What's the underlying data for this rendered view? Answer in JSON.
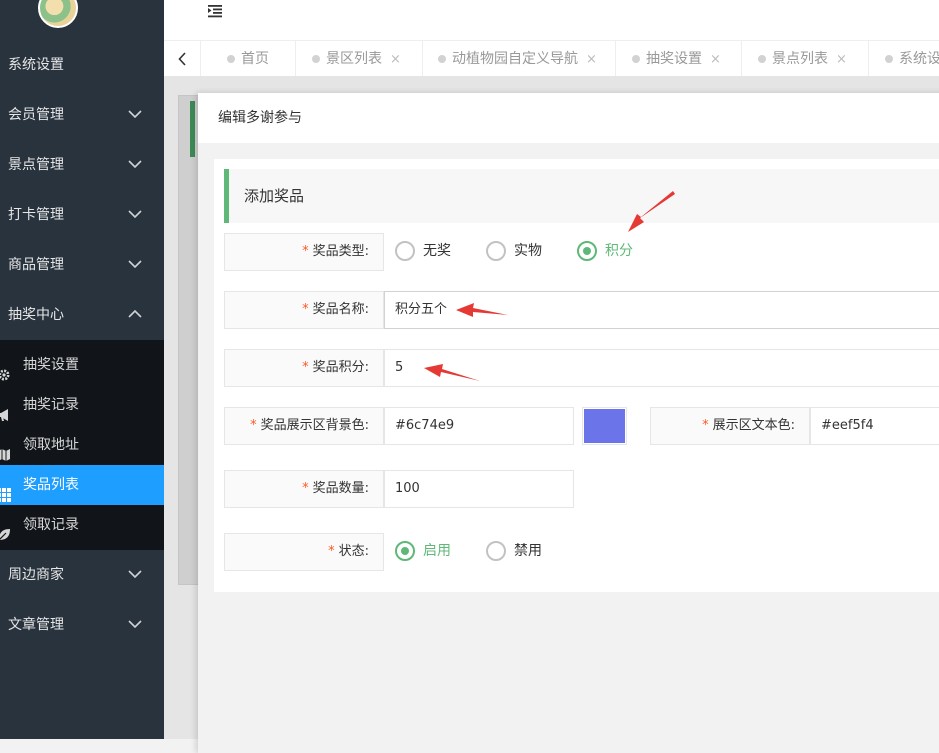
{
  "sidebar": {
    "logo": "park-logo",
    "items": [
      {
        "label": "系统设置",
        "icon": "none"
      },
      {
        "label": "会员管理",
        "icon": "chevron-down-icon"
      },
      {
        "label": "景点管理",
        "icon": "chevron-down-icon"
      },
      {
        "label": "打卡管理",
        "icon": "chevron-down-icon"
      },
      {
        "label": "商品管理",
        "icon": "chevron-down-icon"
      },
      {
        "label": "抽奖中心",
        "icon": "chevron-up-icon"
      },
      {
        "label": "周边商家",
        "icon": "chevron-down-icon"
      },
      {
        "label": "文章管理",
        "icon": "chevron-down-icon"
      }
    ],
    "submenu": [
      {
        "label": "抽奖设置",
        "icon": "gear-icon"
      },
      {
        "label": "抽奖记录",
        "icon": "megaphone-icon"
      },
      {
        "label": "领取地址",
        "icon": "map-icon"
      },
      {
        "label": "奖品列表",
        "icon": "grid-icon",
        "active": true
      },
      {
        "label": "领取记录",
        "icon": "leaf-icon"
      }
    ]
  },
  "header": {
    "menu_toggle_icon": "menu-indent-icon"
  },
  "tabs": [
    {
      "label": "首页",
      "closable": false
    },
    {
      "label": "景区列表",
      "closable": true
    },
    {
      "label": "动植物园自定义导航",
      "closable": true
    },
    {
      "label": "抽奖设置",
      "closable": true
    },
    {
      "label": "景点列表",
      "closable": true
    },
    {
      "label": "系统设",
      "closable": false
    }
  ],
  "tab_close_symbol": "×",
  "modal": {
    "title": "编辑多谢参与",
    "section_title": "添加奖品",
    "required_mark": "*",
    "fields": {
      "prize_type": {
        "label": "奖品类型:",
        "options": [
          "无奖",
          "实物",
          "积分"
        ],
        "selected": "积分"
      },
      "prize_name": {
        "label": "奖品名称:",
        "value": "积分五个"
      },
      "prize_points": {
        "label": "奖品积分:",
        "value": "5"
      },
      "bg_color": {
        "label": "奖品展示区背景色:",
        "value": "#6c74e9",
        "swatch": "#6c74e9"
      },
      "text_color": {
        "label": "展示区文本色:",
        "value": "#eef5f4"
      },
      "quantity": {
        "label": "奖品数量:",
        "value": "100"
      },
      "status": {
        "label": "状态:",
        "options": [
          "启用",
          "禁用"
        ],
        "selected": "启用"
      }
    }
  },
  "colors": {
    "sidebar_bg": "#28333e",
    "submenu_bg": "#11151a",
    "active_blue": "#1e9fff",
    "accent_green": "#5fb878",
    "required_red": "#ff5722",
    "annotation_arrow": "#e53935"
  }
}
